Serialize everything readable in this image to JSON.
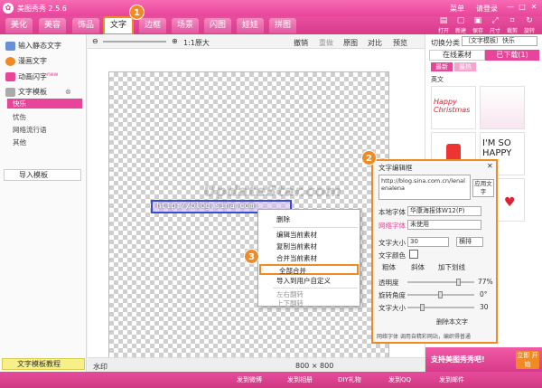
{
  "app": {
    "title": "美图秀秀 2.5.6",
    "menu": "菜单",
    "login": "请登录",
    "min": "—",
    "max": "□",
    "close": "✕"
  },
  "tabs": [
    {
      "label": "美化"
    },
    {
      "label": "美容"
    },
    {
      "label": "饰品"
    },
    {
      "label": "文字"
    },
    {
      "label": "边框"
    },
    {
      "label": "场景"
    },
    {
      "label": "闪图"
    },
    {
      "label": "娃娃"
    },
    {
      "label": "拼图"
    }
  ],
  "toolbar": [
    {
      "icon": "open-icon",
      "label": "打开"
    },
    {
      "icon": "new-icon",
      "label": "新建"
    },
    {
      "icon": "save-icon",
      "label": "保存"
    },
    {
      "icon": "size-icon",
      "label": "尺寸"
    },
    {
      "icon": "crop-icon",
      "label": "裁剪"
    },
    {
      "icon": "rotate-icon",
      "label": "旋转"
    }
  ],
  "badges": [
    "1",
    "2",
    "3"
  ],
  "left": {
    "items": [
      {
        "label": "输入静态文字",
        "color": "#6b8fd6"
      },
      {
        "label": "漫画文字",
        "color": "#f08a24"
      },
      {
        "label": "动画闪字",
        "color": "#e8459a",
        "tag": "new"
      }
    ],
    "template": {
      "label": "文字模板",
      "subs": [
        "快乐",
        "忧伤",
        "网络流行语",
        "其他"
      ]
    },
    "import": "导入模板",
    "tutorial": "文字模板教程"
  },
  "canvas": {
    "zoom": "1:1原大",
    "undo": "撤销",
    "redo": "重做",
    "orig": "原图",
    "compare": "对比",
    "preview": "预览",
    "text": "http://blog.sina.com.",
    "status_left": "水印",
    "size": "800 × 800"
  },
  "context_menu": [
    "删除",
    "编辑当前素材",
    "复制当前素材",
    "合并当前素材",
    "全部合并",
    "导入到用户自定义",
    "左右翻转",
    "上下翻转"
  ],
  "right": {
    "category_label": "切换分类",
    "category_value": "〔文字模板〕快乐",
    "tab_online": "在线素材",
    "tab_downloaded": "已下载(1)",
    "sort_new": "最新",
    "sort_hot": "最热",
    "english": "英文",
    "thumb_texts": [
      "Happy Christmas",
      "",
      "I'M SO HAPPY",
      ""
    ]
  },
  "dialog": {
    "title": "文字编辑框",
    "close": "✕",
    "text": "http://blog.sina.com.cn/lenalenalena",
    "apply": "应用文字",
    "font_label": "本地字体",
    "font_value": "华康海报体W12(P)",
    "net_font_label": "网络字体",
    "net_font_value": "未使用",
    "size_label": "文字大小",
    "size_value": "30",
    "orient_value": "横排",
    "color_label": "文字颜色",
    "bold": "粗体",
    "italic": "斜体",
    "underline": "加下划线",
    "opacity_label": "透明度",
    "opacity_value": "77%",
    "angle_label": "旋转角度",
    "angle_value": "0°",
    "fontsize_label": "文字大小",
    "fontsize_value": "30",
    "delete": "删除本文字",
    "net_hint": "网络字体 调用自精彩网站，编织得普通"
  },
  "bottom": {
    "share": "支持美图秀秀吧!",
    "cta": "立即 开始",
    "links": [
      "发到微博",
      "发到相册",
      "DIY礼物",
      "发到QQ",
      "发到邮件"
    ]
  },
  "watermark": "UpdateStar.com",
  "colors": {
    "accent": "#e8459a",
    "badge": "#f08a24"
  }
}
